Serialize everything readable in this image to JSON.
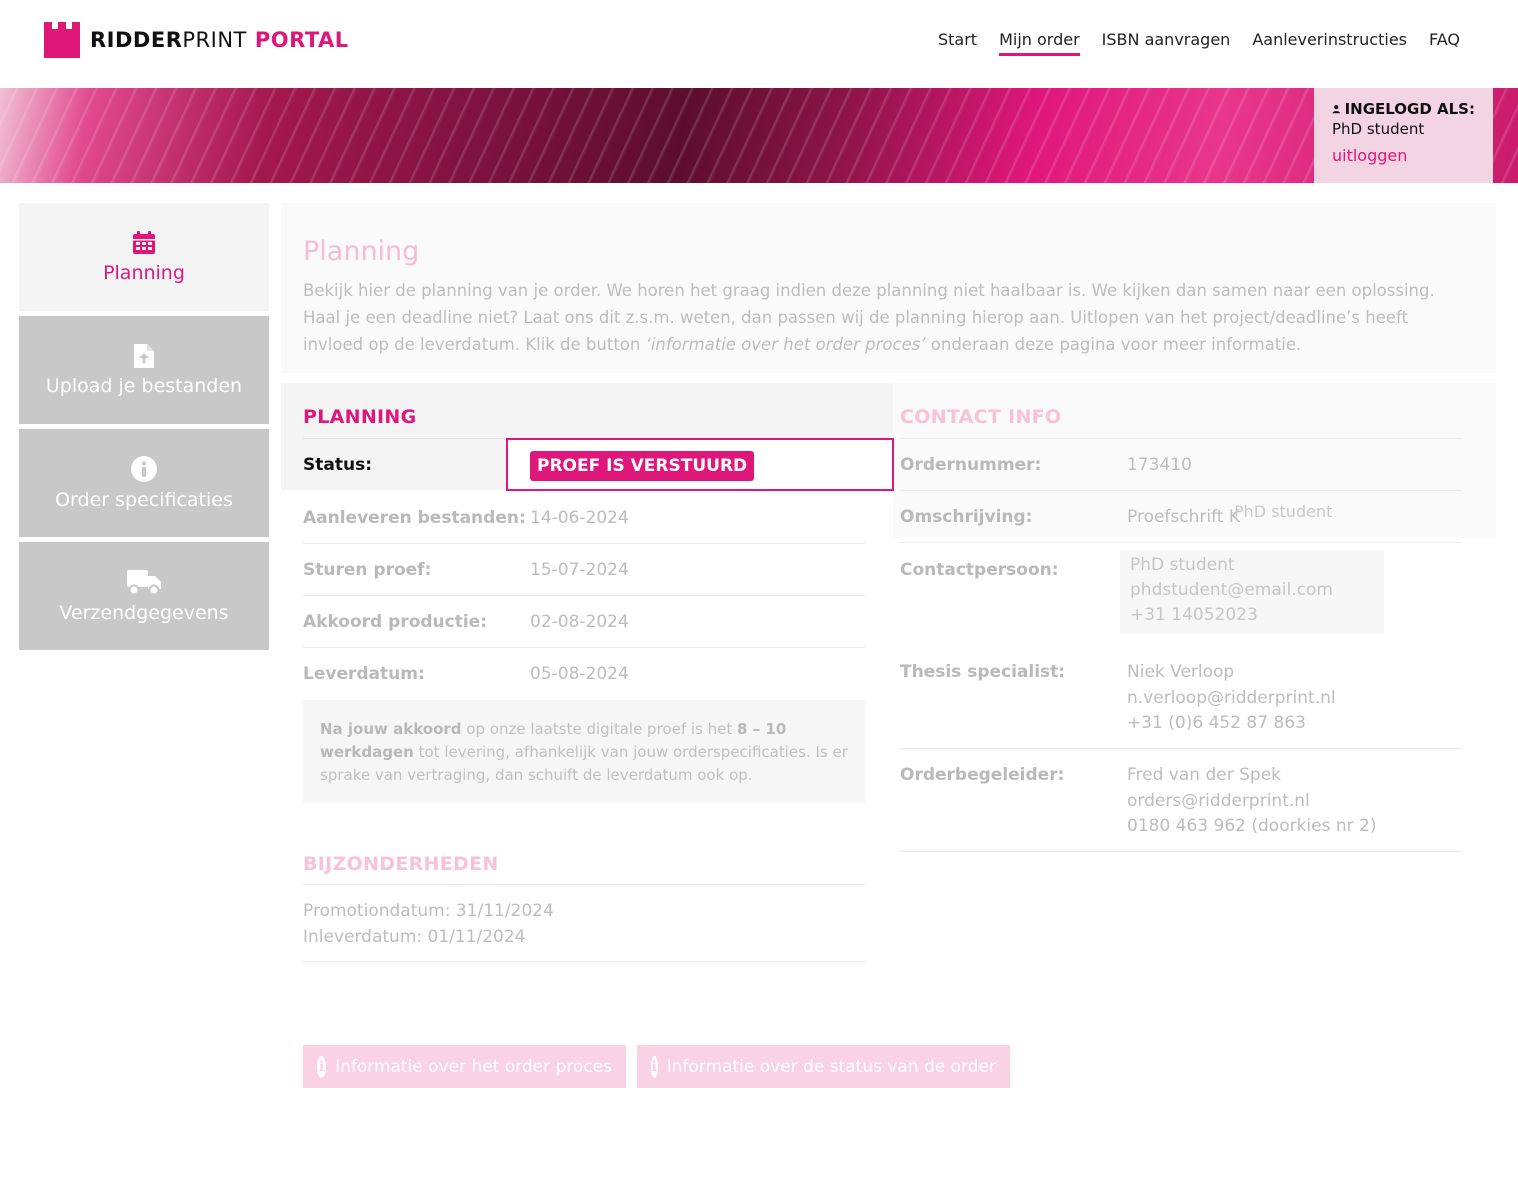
{
  "brand": {
    "name_bold": "RIDDER",
    "name_light": "PRINT",
    "name_accent": "PORTAL",
    "accent_color": "#e0177b"
  },
  "nav": {
    "items": [
      "Start",
      "Mijn order",
      "ISBN aanvragen",
      "Aanleverinstructies",
      "FAQ"
    ],
    "active": "Mijn order"
  },
  "login": {
    "title": "INGELOGD ALS:",
    "user": "PhD student",
    "logout": "uitloggen"
  },
  "sidebar": {
    "items": [
      {
        "label": "Planning",
        "icon": "calendar-icon",
        "active": true
      },
      {
        "label": "Upload je bestanden",
        "icon": "file-upload-icon",
        "active": false
      },
      {
        "label": "Order specificaties",
        "icon": "info-icon",
        "active": false
      },
      {
        "label": "Verzendgegevens",
        "icon": "truck-icon",
        "active": false
      }
    ]
  },
  "intro": {
    "title": "Planning",
    "text_before": "Bekijk hier de planning van je order. We horen het graag indien deze planning niet haalbaar is. We kijken dan samen naar een oplossing. Haal je een deadline niet? Laat ons dit z.s.m. weten, dan passen wij de planning hierop aan. Uitlopen van het project/deadline’s heeft invloed op de leverdatum. Klik de button ",
    "text_italic": "‘informatie over het order proces’",
    "text_after": " onderaan deze pagina voor meer informatie."
  },
  "planning": {
    "title": "PLANNING",
    "status_label": "Status:",
    "status_value": "PROEF IS VERSTUURD",
    "rows": [
      {
        "label": "Aanleveren bestanden:",
        "value": "14-06-2024"
      },
      {
        "label": "Sturen proef:",
        "value": "15-07-2024"
      },
      {
        "label": "Akkoord productie:",
        "value": "02-08-2024"
      },
      {
        "label": "Leverdatum:",
        "value": "05-08-2024"
      }
    ],
    "note": {
      "b1": "Na jouw akkoord",
      "t1": " op onze laatste digitale proef is het ",
      "b2": "8 – 10 werkdagen",
      "t2": " tot levering, afhankelijk van jouw orderspecificaties. Is er sprake van vertraging, dan schuift de leverdatum ook op."
    }
  },
  "bijzonderheden": {
    "title": "BIJZONDERHEDEN",
    "lines": [
      "Promotiondatum: 31/11/2024",
      "Inleverdatum: 01/11/2024"
    ]
  },
  "contact": {
    "title": "CONTACT INFO",
    "ordernummer_label": "Ordernummer:",
    "ordernummer_value": "173410",
    "omschrijving_label": "Omschrijving:",
    "omschrijving_value": "Proefschrift K",
    "omschrijving_overlay": "PhD student",
    "contactpersoon_label": "Contactpersoon:",
    "contactpersoon_lines": [
      "PhD student",
      "phdstudent@email.com",
      "+31 14052023"
    ],
    "thesis_label": "Thesis specialist:",
    "thesis_lines": [
      "Niek Verloop",
      "n.verloop@ridderprint.nl",
      "+31 (0)6 452 87 863"
    ],
    "begeleider_label": "Orderbegeleider:",
    "begeleider_lines": [
      "Fred van der Spek",
      "orders@ridderprint.nl",
      "0180 463 962 (doorkies nr 2)"
    ]
  },
  "buttons": {
    "order_proces": "Informatie over het order proces",
    "status_order": "Informatie over de status van de order"
  }
}
